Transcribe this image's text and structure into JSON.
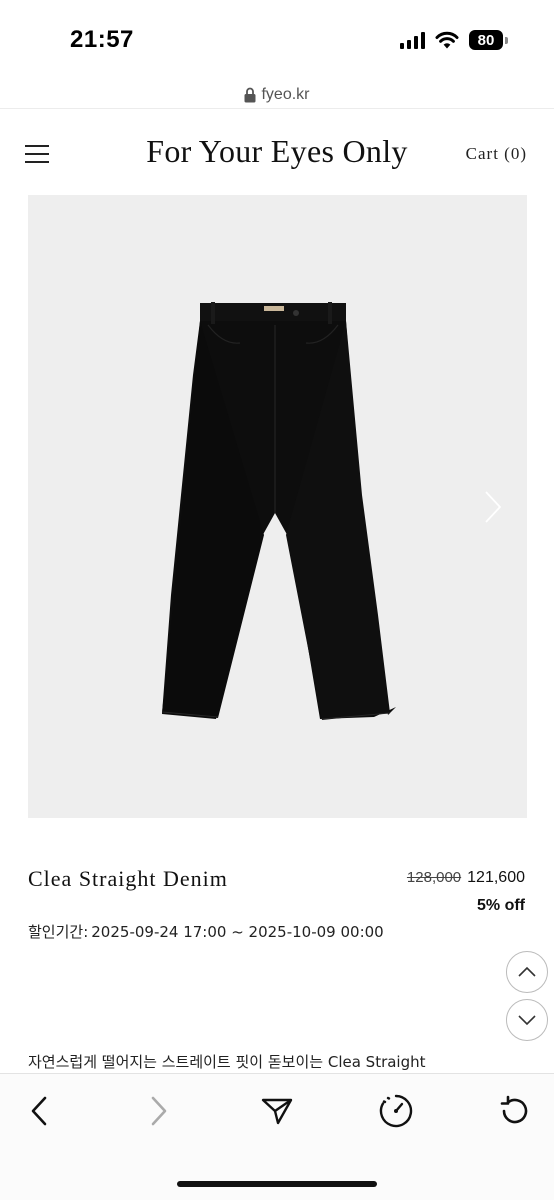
{
  "status_bar": {
    "time": "21:57",
    "battery": "80",
    "icons": [
      "signal-icon",
      "wifi-icon",
      "battery-icon"
    ]
  },
  "browser": {
    "url": "fyeo.kr",
    "icons": [
      "lock-icon"
    ]
  },
  "site_header": {
    "brand": "For Your Eyes Only",
    "cart_label": "Cart (0)",
    "icons": [
      "menu-icon"
    ]
  },
  "product": {
    "name": "Clea Straight Denim",
    "original_price": "128,000",
    "sale_price": "121,600",
    "discount": "5% off",
    "sale_period_label": "할인기간:",
    "sale_period": "2025-09-24 17:00 ~ 2025-10-09 00:00",
    "description": "자연스럽게 떨어지는 스트레이트 핏이 돋보이는 Clea Straight",
    "image_alt": "black straight denim jeans"
  },
  "colors": {
    "image_background": "#eeeeee",
    "jeans": "#0d0d0d",
    "text": "#111111"
  },
  "toolbar": {
    "icons": [
      "back-icon",
      "forward-icon",
      "share-icon",
      "speed-icon",
      "reload-icon"
    ]
  }
}
